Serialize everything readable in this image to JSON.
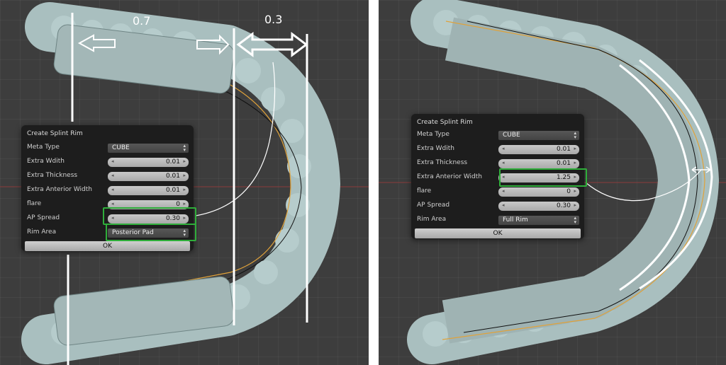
{
  "left_panel": {
    "annotation_left": "0.7",
    "annotation_right": "0.3",
    "dialog": {
      "title": "Create Splint Rim",
      "meta_type": {
        "label": "Meta Type",
        "value": "CUBE"
      },
      "extra_width": {
        "label": "Extra Wdith",
        "value": "0.01"
      },
      "extra_thickness": {
        "label": "Extra Thickness",
        "value": "0.01"
      },
      "extra_anterior_width": {
        "label": "Extra Anterior Width",
        "value": "0.01"
      },
      "flare": {
        "label": "flare",
        "value": "0"
      },
      "ap_spread": {
        "label": "AP Spread",
        "value": "0.30"
      },
      "rim_area": {
        "label": "Rim Area",
        "value": "Posterior Pad"
      },
      "ok_label": "OK"
    }
  },
  "right_panel": {
    "dialog": {
      "title": "Create Splint Rim",
      "meta_type": {
        "label": "Meta Type",
        "value": "CUBE"
      },
      "extra_width": {
        "label": "Extra Wdith",
        "value": "0.01"
      },
      "extra_thickness": {
        "label": "Extra Thickness",
        "value": "0.01"
      },
      "extra_anterior_width": {
        "label": "Extra Anterior Width",
        "value": "1.25"
      },
      "flare": {
        "label": "flare",
        "value": "0"
      },
      "ap_spread": {
        "label": "AP Spread",
        "value": "0.30"
      },
      "rim_area": {
        "label": "Rim Area",
        "value": "Full Rim"
      },
      "ok_label": "OK"
    }
  },
  "colors": {
    "viewport_bg": "#3d3d3d",
    "model_fill": "#a7bdbd",
    "rim_fill": "#9fb3b3",
    "highlight": "#2fae3a",
    "outline_orange": "#e0a23a",
    "annotation": "#ffffff",
    "axis_red": "#8a3a3a"
  }
}
